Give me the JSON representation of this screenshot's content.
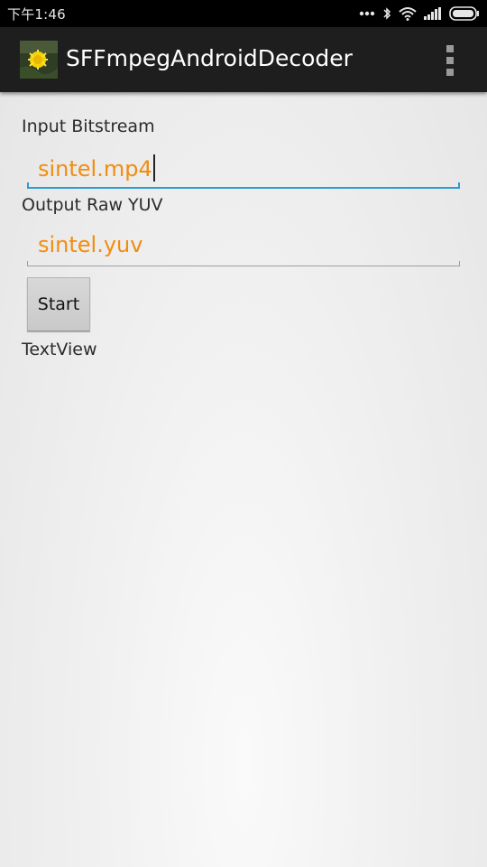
{
  "status_bar": {
    "time": "下午1:46",
    "icons": [
      "more-dots-icon",
      "bluetooth-icon",
      "wifi-icon",
      "signal-icon",
      "battery-icon"
    ]
  },
  "action_bar": {
    "app_title": "SFFmpegAndroidDecoder",
    "app_icon": "dandelion-app-icon",
    "overflow_icon": "overflow-menu-icon"
  },
  "form": {
    "input_label": "Input Bitstream",
    "input_value": "sintel.mp4",
    "output_label": "Output Raw YUV",
    "output_value": "sintel.yuv",
    "start_label": "Start",
    "textview": "TextView"
  },
  "colors": {
    "field_text": "#f28c0f",
    "focus_accent": "#2f9bd5",
    "action_bar": "#1e1e1e",
    "status_bar": "#000000"
  }
}
